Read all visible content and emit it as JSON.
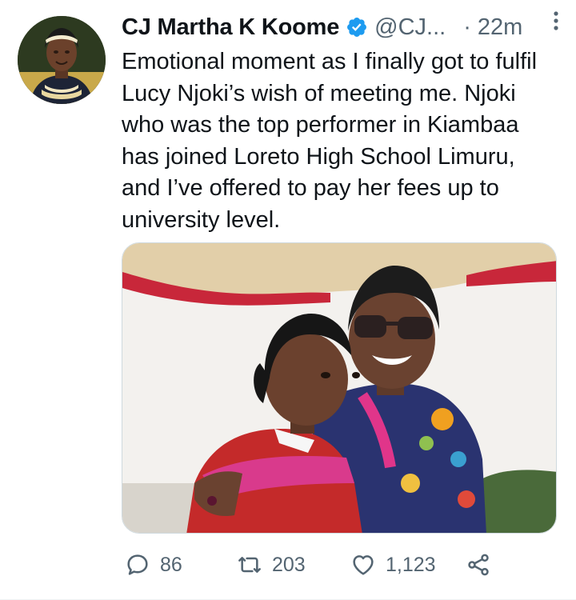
{
  "tweet": {
    "author_name": "CJ Martha K Koome",
    "handle": "@CJ...",
    "separator": "·",
    "time": "22m",
    "text": "Emotional moment as I finally got to fulfil Lucy Njoki’s wish of meeting me. Njoki who was the top performer in Kiambaa has joined Loreto High School Limuru, and I’ve offered to pay her fees up to university level.",
    "icons": {
      "verified": "verified-badge-icon",
      "more": "more-options-icon",
      "reply": "reply-icon",
      "retweet": "retweet-icon",
      "like": "like-icon",
      "share": "share-icon"
    },
    "stats": {
      "replies": "86",
      "retweets": "203",
      "likes": "1,123"
    },
    "colors": {
      "verified": "#1d9bf0",
      "text": "#0f1419",
      "secondary": "#536471"
    }
  }
}
